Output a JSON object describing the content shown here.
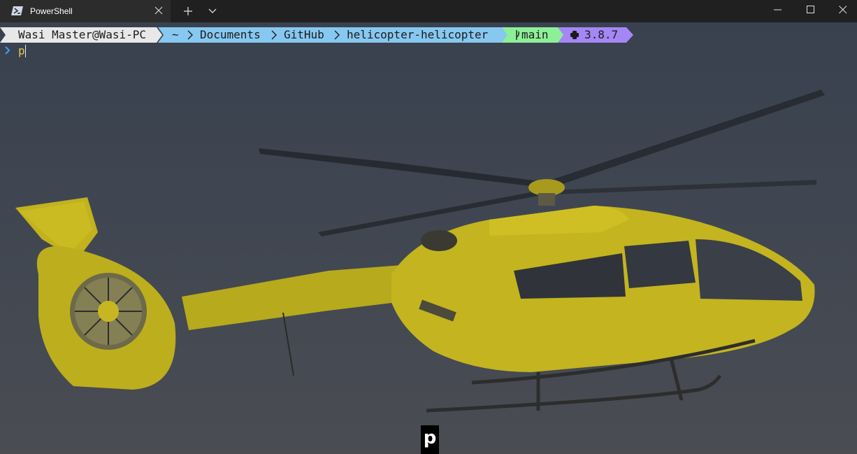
{
  "window": {
    "tab_title": "PowerShell",
    "tab_icon": "powershell-icon",
    "controls": [
      "minimize-icon",
      "maximize-icon",
      "close-icon"
    ]
  },
  "prompt": {
    "user": "Wasi Master@Wasi-PC",
    "path": [
      "~",
      "Documents",
      "GitHub",
      "helicopter-helicopter"
    ],
    "git_branch": "main",
    "git_icon": "git-branch-icon",
    "python_version": "3.8.7",
    "python_icon": "python-icon",
    "colors": {
      "user": "#e8e8e8",
      "path": "#87c8f0",
      "git": "#8ef096",
      "python": "#a586f5"
    }
  },
  "input": {
    "prompt_symbol": "❯",
    "typed_text": "p"
  },
  "key_overlay": {
    "key": "p"
  },
  "background": {
    "subject": "yellow helicopter",
    "tint": "#3f4651"
  }
}
